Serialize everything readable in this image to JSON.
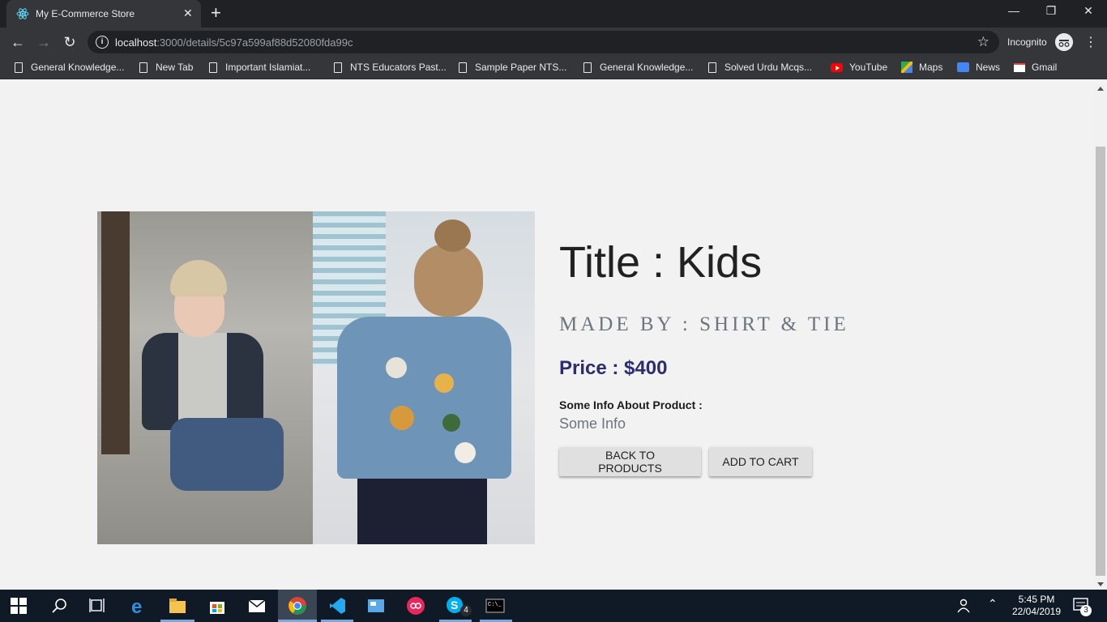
{
  "browser": {
    "tab_title": "My E-Commerce Store",
    "tab_close": "✕",
    "new_tab": "+",
    "url_host": "localhost",
    "url_path": ":3000/details/5c97a599af88d52080fda99c",
    "mode_label": "Incognito",
    "window_controls": [
      "—",
      "❐",
      "✕"
    ]
  },
  "bookmarks": [
    {
      "label": "General Knowledge...",
      "icon": "page-icon"
    },
    {
      "label": "New Tab",
      "icon": "page-icon"
    },
    {
      "label": "Important Islamiat...",
      "icon": "page-icon"
    },
    {
      "label": "NTS Educators Past...",
      "icon": "page-icon"
    },
    {
      "label": "Sample Paper NTS...",
      "icon": "page-icon"
    },
    {
      "label": "General Knowledge...",
      "icon": "page-icon"
    },
    {
      "label": "Solved Urdu Mcqs...",
      "icon": "page-icon"
    },
    {
      "label": "YouTube",
      "icon": "youtube-icon"
    },
    {
      "label": "Maps",
      "icon": "maps-icon"
    },
    {
      "label": "News",
      "icon": "news-icon"
    },
    {
      "label": "Gmail",
      "icon": "gmail-icon"
    }
  ],
  "product": {
    "title": "Title : Kids",
    "made_by": "MADE BY : SHIRT & TIE",
    "price": "Price : $400",
    "info_label": "Some Info About Product :",
    "info_value": "Some Info",
    "back_button": "BACK TO PRODUCTS",
    "cart_button": "ADD TO CART"
  },
  "taskbar": {
    "time": "5:45 PM",
    "date": "22/04/2019",
    "skype_badge": "4",
    "notifications_badge": "3"
  }
}
